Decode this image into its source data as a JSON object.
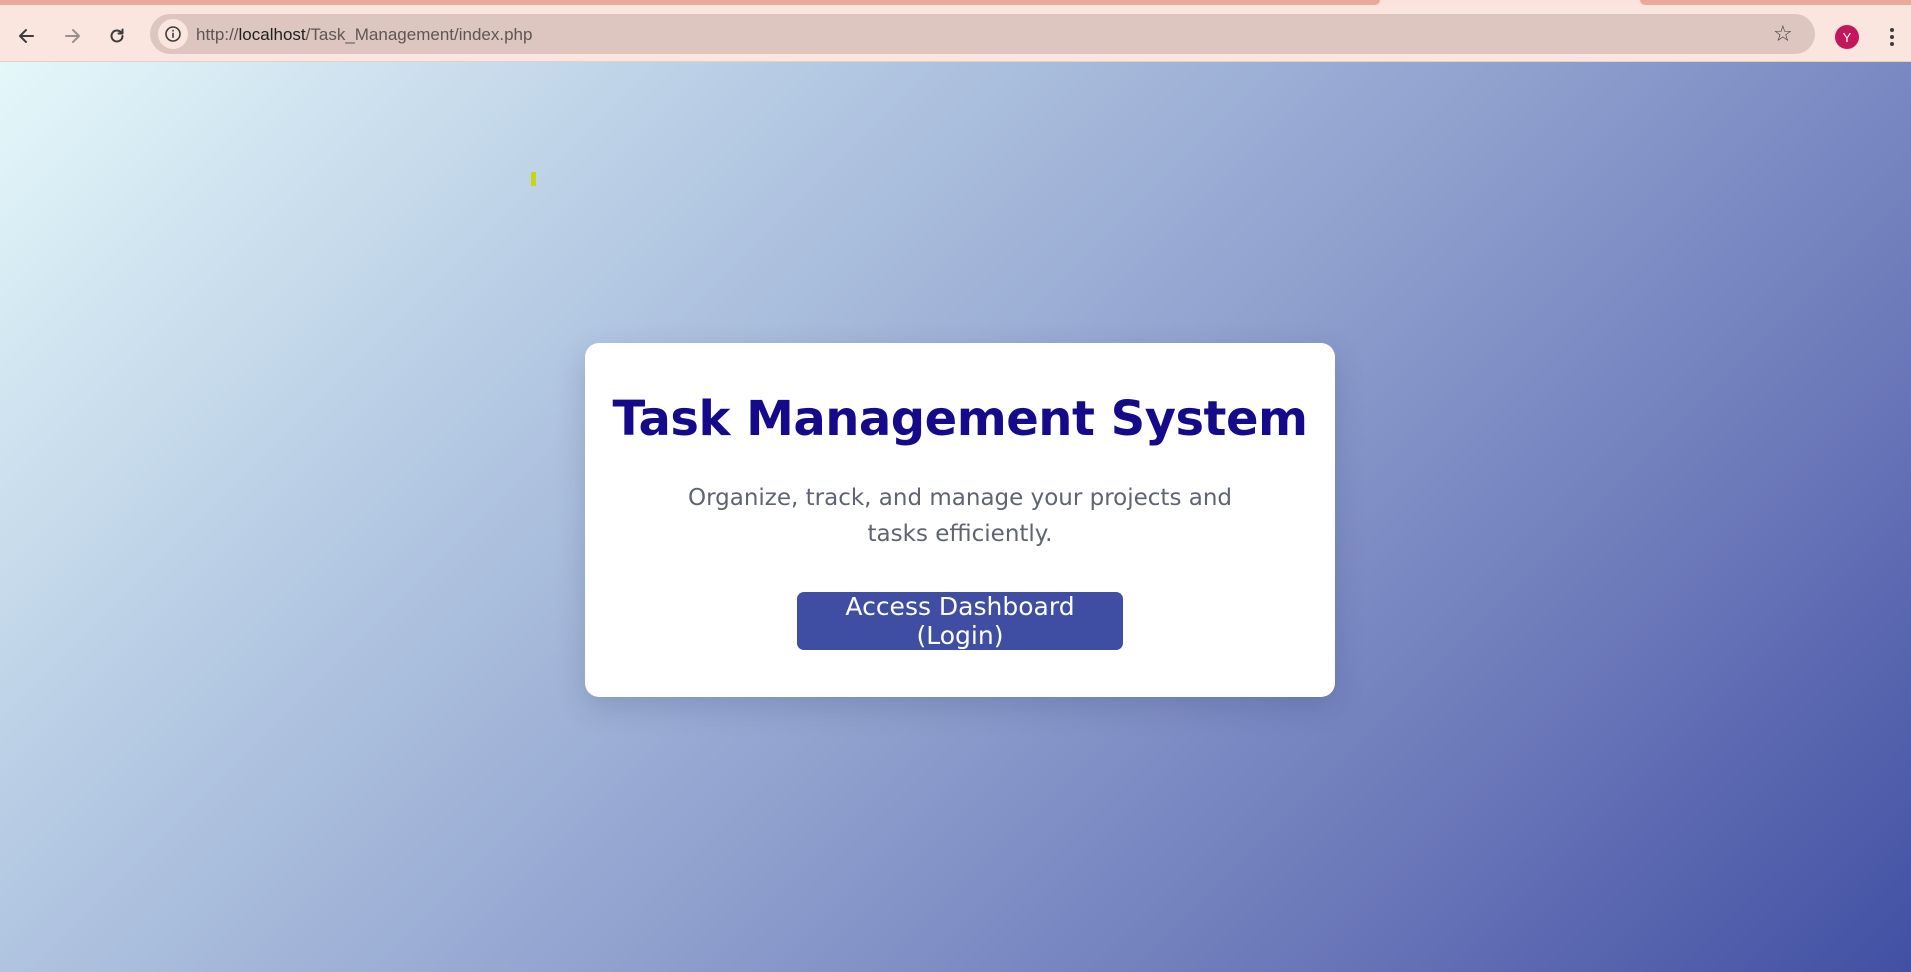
{
  "browser": {
    "url_prefix": "http://",
    "url_host": "localhost",
    "url_path": "/Task_Management/index.php",
    "profile_initial": "Y",
    "icons": {
      "back": "arrow-left-icon",
      "forward": "arrow-right-icon",
      "reload": "reload-icon",
      "site_info": "info-icon",
      "bookmark": "star-icon",
      "menu": "kebab-menu-icon"
    },
    "colors": {
      "toolbar": "#fbe6df",
      "omnibox": "#dcc6bf",
      "avatar": "#c2185b"
    }
  },
  "page": {
    "title": "Task Management System",
    "subtitle": "Organize, track, and manage your projects and tasks efficiently.",
    "cta_label": "Access Dashboard (Login)",
    "colors": {
      "title": "#140a8a",
      "button": "#3f4ea3",
      "gradient_start": "#e4f8fa",
      "gradient_end": "#4250a4"
    }
  }
}
